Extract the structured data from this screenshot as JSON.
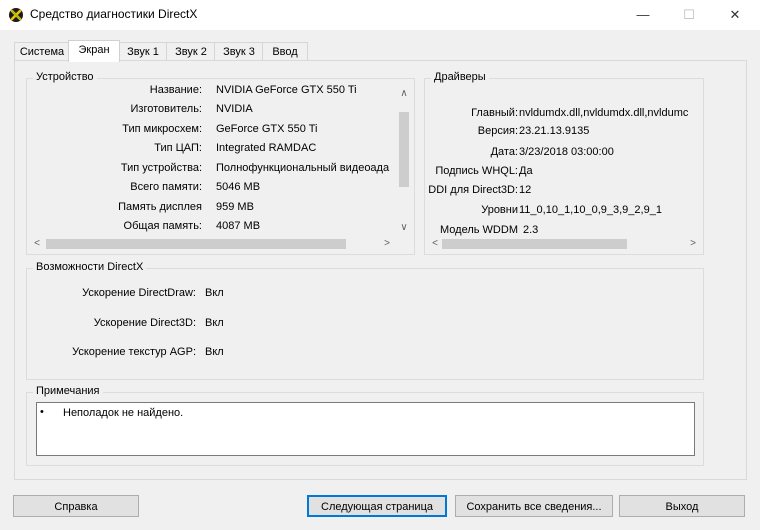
{
  "window": {
    "title": "Средство диагностики DirectX",
    "controls": {
      "minimize": "—",
      "maximize": "☐",
      "close": "✕"
    }
  },
  "tabs": [
    {
      "label": "Система",
      "active": false
    },
    {
      "label": "Экран",
      "active": true
    },
    {
      "label": "Звук 1",
      "active": false
    },
    {
      "label": "Звук 2",
      "active": false
    },
    {
      "label": "Звук 3",
      "active": false
    },
    {
      "label": "Ввод",
      "active": false
    }
  ],
  "device": {
    "title": "Устройство",
    "rows": [
      {
        "label": "Название:",
        "value": "NVIDIA GeForce GTX 550 Ti"
      },
      {
        "label": "Изготовитель:",
        "value": "NVIDIA"
      },
      {
        "label": "Тип микросхем:",
        "value": "GeForce GTX 550 Ti"
      },
      {
        "label": "Тип ЦАП:",
        "value": "Integrated RAMDAC"
      },
      {
        "label": "Тип устройства:",
        "value": "Полнофункциональный видеоада"
      },
      {
        "label": "Всего памяти:",
        "value": "5046 MB"
      },
      {
        "label": "Память дисплея",
        "value": "959 MB"
      },
      {
        "label": "Общая память:",
        "value": "4087 MB"
      }
    ]
  },
  "drivers": {
    "title": "Драйверы",
    "rows": [
      {
        "label": "Главный:",
        "value": "nvldumdx.dll,nvldumdx.dll,nvldumc"
      },
      {
        "label": "Версия:",
        "value": "23.21.13.9135"
      },
      {
        "label": "Дата:",
        "value": "3/23/2018 03:00:00"
      },
      {
        "label": "Подпись WHQL:",
        "value": "Да"
      },
      {
        "label": "DDI для Direct3D:",
        "value": "12"
      },
      {
        "label": "Уровни",
        "value": "11_0,10_1,10_0,9_3,9_2,9_1"
      },
      {
        "label": "Модель WDDM",
        "value": "2.3"
      }
    ]
  },
  "directx": {
    "title": "Возможности DirectX",
    "rows": [
      {
        "label": "Ускорение DirectDraw:",
        "value": "Вкл"
      },
      {
        "label": "Ускорение Direct3D:",
        "value": "Вкл"
      },
      {
        "label": "Ускорение текстур AGP:",
        "value": "Вкл"
      }
    ]
  },
  "notes": {
    "title": "Примечания",
    "items": [
      {
        "bullet": "•",
        "text": "Неполадок не найдено."
      }
    ]
  },
  "buttons": {
    "help": "Справка",
    "next_page": "Следующая страница",
    "save_all": "Сохранить все сведения...",
    "exit": "Выход"
  }
}
